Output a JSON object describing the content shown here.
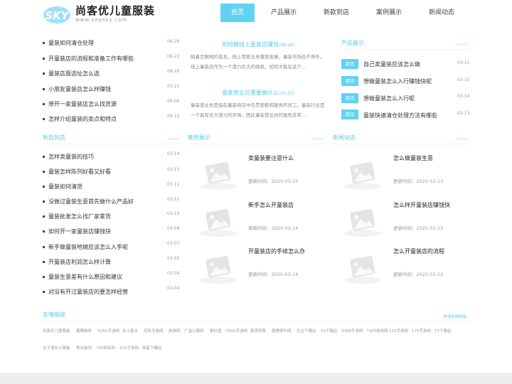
{
  "header": {
    "logo_badge": "SKY",
    "logo_text": "尚客优儿童服装",
    "logo_url": "www.sepsky.com",
    "nav": [
      "首页",
      "产品展示",
      "新款到店",
      "案例展示",
      "新闻动态"
    ]
  },
  "top_list": [
    {
      "title": "童装如何清仓处理",
      "date": "06-29"
    },
    {
      "title": "开童装店的流程和准备工作有哪些",
      "date": "08-22"
    },
    {
      "title": "童装店面选址怎么选",
      "date": "08-26"
    },
    {
      "title": "小朋友童装店怎么样赚钱",
      "date": "05-21"
    },
    {
      "title": "想开一家童装店怎么找货源",
      "date": "06-06"
    },
    {
      "title": "怎样介绍童装的卖点和特点",
      "date": "09-12"
    }
  ],
  "featured": [
    {
      "title": "如何做线上童装店赚钱",
      "date": "(08-16)",
      "desc": "随着互联网的普及，线上零售业务蓬勃发展，童装市场也不例外。线上童装店作为一个潜力巨大的商机，如何才能在这个..."
    },
    {
      "title": "童装营业员需要做什么",
      "date": "(05-25)",
      "desc": "童装营业员是指在童装商店中负责销售和服务的员工。童装行业是一个具有巨大潜力的市场，因此童装营业员的角色非常..."
    }
  ],
  "products": {
    "title": "产品展示",
    "more": "more+",
    "tag": "资讯",
    "items": [
      {
        "title": "自己卖童装应该怎么做",
        "date": "03-15"
      },
      {
        "title": "想做童装怎么入行赚钱快呢",
        "date": "03-15"
      },
      {
        "title": "想做童装怎么入行呢",
        "date": "03-14"
      },
      {
        "title": "童装快速清仓处理方法有哪些",
        "date": "03-13"
      }
    ]
  },
  "new_arrivals": {
    "title": "新款到店",
    "more": "more+",
    "items": [
      {
        "title": "怎样卖童装的技巧",
        "date": "03-14"
      },
      {
        "title": "童装怎样陈列好看又好看",
        "date": "03-13"
      },
      {
        "title": "童装如何清货",
        "date": "03-11"
      },
      {
        "title": "没做过童装生意首先做什么产品好",
        "date": "03-10"
      },
      {
        "title": "童装批发怎么找厂家拿货",
        "date": "03-10"
      },
      {
        "title": "如何开一家童装店赚钱快",
        "date": "03-08"
      },
      {
        "title": "新手做童装地摊应该怎么入手呢",
        "date": "03-07"
      },
      {
        "title": "开童装店利润怎么样计算",
        "date": "03-05"
      },
      {
        "title": "童装生意差有什么原因和建议",
        "date": "03-04"
      },
      {
        "title": "对没有开过童装店的要怎样经营",
        "date": "03-04"
      }
    ]
  },
  "cases": {
    "title": "案例展示",
    "more": "more+",
    "items": [
      {
        "title": "卖童装要注意什么",
        "date": "更新时间：2025-03-15"
      },
      {
        "title": "新手怎么开童装店",
        "date": "更新时间：2025-03-14"
      },
      {
        "title": "开童装店的手续怎么办",
        "date": "更新时间：2025-03-14"
      }
    ]
  },
  "news": {
    "title": "新闻动态",
    "more": "more+",
    "items": [
      {
        "title": "怎么做童装生意",
        "date": "更新时间：2025-03-13"
      },
      {
        "title": "怎么样开童装店赚钱快",
        "date": "更新时间：2025-03-12"
      },
      {
        "title": "怎么开童装店的流程",
        "date": "更新时间：2025-03-12"
      }
    ]
  },
  "friend_links": {
    "title": "友情链接",
    "apply": "申请友情链接",
    "items": [
      "尚客优儿童服装",
      "鹏腾装修",
      "925G手游网",
      "女士香水",
      "宏科鸟龟网",
      "旅游网",
      "广溢火腿网",
      "紫砂壶",
      "700G手游网",
      "鑫源测泵",
      "香糯茶叶网",
      "左边下载站",
      "52下载站",
      "3366手游网",
      "7165游戏网",
      "123手游网",
      "175手游网",
      "77下载站",
      "太子港女士服装",
      "秀吉装饰",
      "700彩虹网",
      "223手游网",
      "恒星下载站"
    ]
  },
  "colors": {
    "accent": "#5fd3f3",
    "title_blue": "#5fc8ea"
  }
}
